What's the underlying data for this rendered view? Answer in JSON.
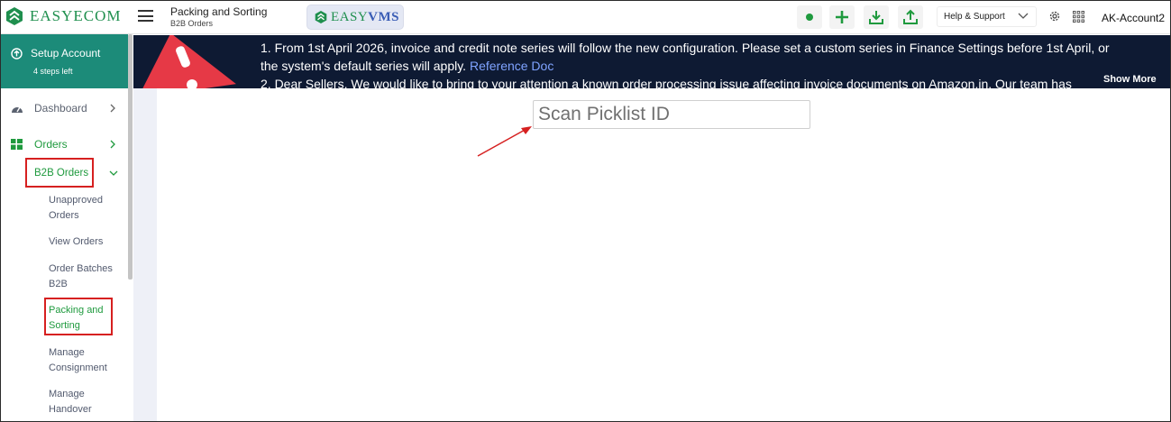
{
  "topbar": {
    "logo_text": "EASYECOM",
    "page_title": "Packing and Sorting",
    "page_subtitle": "B2B Orders",
    "vms_part1": "EASY",
    "vms_part2": "VMS",
    "help_label": "Help & Support",
    "account_name": "AK-Account2",
    "icons": [
      "status-dot-icon",
      "add-icon",
      "download-icon",
      "upload-icon",
      "gear-icon",
      "apps-grid-icon"
    ]
  },
  "sidebar": {
    "setup_title": "Setup Account",
    "setup_subtitle": "4 steps left",
    "dashboard_label": "Dashboard",
    "orders_label": "Orders",
    "b2b_orders_label": "B2B Orders",
    "sub_items": [
      "Unapproved Orders",
      "View Orders",
      "Order Batches B2B",
      "Packing and Sorting",
      "Manage Consignment",
      "Manage Handover"
    ]
  },
  "banner": {
    "line1": "1. From 1st April 2026, invoice and credit note series will follow the new configuration. Please set a custom series in Finance Settings before 1st April, or",
    "line2_text": "the system's default series will apply. ",
    "line2_link": "Reference Doc",
    "line3": "2. Dear Sellers, We would like to bring to your attention a known order processing issue affecting invoice documents on Amazon.in. Our team has",
    "show_more": "Show More"
  },
  "main": {
    "scan_placeholder": "Scan Picklist ID"
  },
  "colors": {
    "brand_green": "#1f8f4e",
    "setup_teal": "#1c8b79",
    "banner_navy": "#0e1a33",
    "highlight_red": "#d62020"
  }
}
